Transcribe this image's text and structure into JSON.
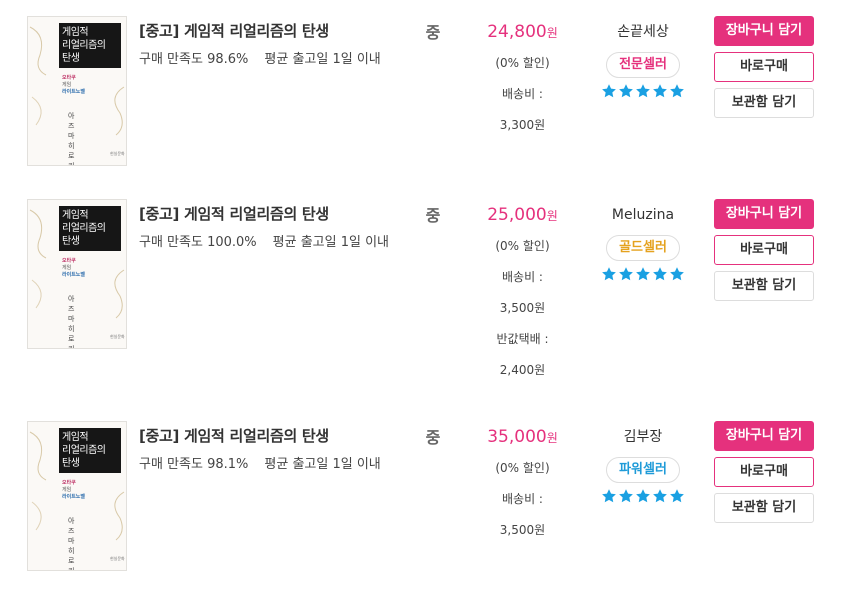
{
  "listings": [
    {
      "cover": {
        "title_lines": [
          "게임적",
          "리얼리즘의",
          "탄생"
        ],
        "sub_lines": [
          "오타쿠",
          "게임",
          "라이트노벨"
        ],
        "author": "아즈마 히로키",
        "publisher": "현실문화"
      },
      "title": "[중고] 게임적 리얼리즘의 탄생",
      "satisfaction_label": "구매 만족도",
      "satisfaction": "98.6%",
      "shipping_day": "평균 출고일 1일 이내",
      "condition": "중",
      "price": "24,800",
      "price_unit": "원",
      "discount": "(0% 할인)",
      "shipping_label": "배송비 :",
      "shipping_fee": "3,300원",
      "seller": "손끝세상",
      "grade": "전문셀러",
      "grade_color": "#e5317d",
      "stars": 5,
      "buttons": {
        "cart": "장바구니 담기",
        "buy": "바로구매",
        "save": "보관함 담기"
      }
    },
    {
      "cover": {
        "title_lines": [
          "게임적",
          "리얼리즘의",
          "탄생"
        ],
        "sub_lines": [
          "오타쿠",
          "게임",
          "라이트노벨"
        ],
        "author": "아즈마 히로키",
        "publisher": "현실문화"
      },
      "title": "[중고] 게임적 리얼리즘의 탄생",
      "satisfaction_label": "구매 만족도",
      "satisfaction": "100.0%",
      "shipping_day": "평균 출고일 1일 이내",
      "condition": "중",
      "price": "25,000",
      "price_unit": "원",
      "discount": "(0% 할인)",
      "shipping_label": "배송비 :",
      "shipping_fee": "3,500원",
      "extra_label": "반값택배 :",
      "extra_fee": "2,400원",
      "seller": "Meluzina",
      "grade": "골드셀러",
      "grade_color": "#e5a21f",
      "stars": 5,
      "buttons": {
        "cart": "장바구니 담기",
        "buy": "바로구매",
        "save": "보관함 담기"
      }
    },
    {
      "cover": {
        "title_lines": [
          "게임적",
          "리얼리즘의",
          "탄생"
        ],
        "sub_lines": [
          "오타쿠",
          "게임",
          "라이트노벨"
        ],
        "author": "아즈마 히로키",
        "publisher": "현실문화"
      },
      "title": "[중고] 게임적 리얼리즘의 탄생",
      "satisfaction_label": "구매 만족도",
      "satisfaction": "98.1%",
      "shipping_day": "평균 출고일 1일 이내",
      "condition": "중",
      "price": "35,000",
      "price_unit": "원",
      "discount": "(0% 할인)",
      "shipping_label": "배송비 :",
      "shipping_fee": "3,500원",
      "seller": "김부장",
      "grade": "파워셀러",
      "grade_color": "#1f9bd8",
      "stars": 5,
      "buttons": {
        "cart": "장바구니 담기",
        "buy": "바로구매",
        "save": "보관함 담기"
      }
    }
  ],
  "colors": {
    "accent": "#e5317d",
    "star": "#1aa0e2"
  },
  "icons": {
    "star": "star-icon"
  }
}
